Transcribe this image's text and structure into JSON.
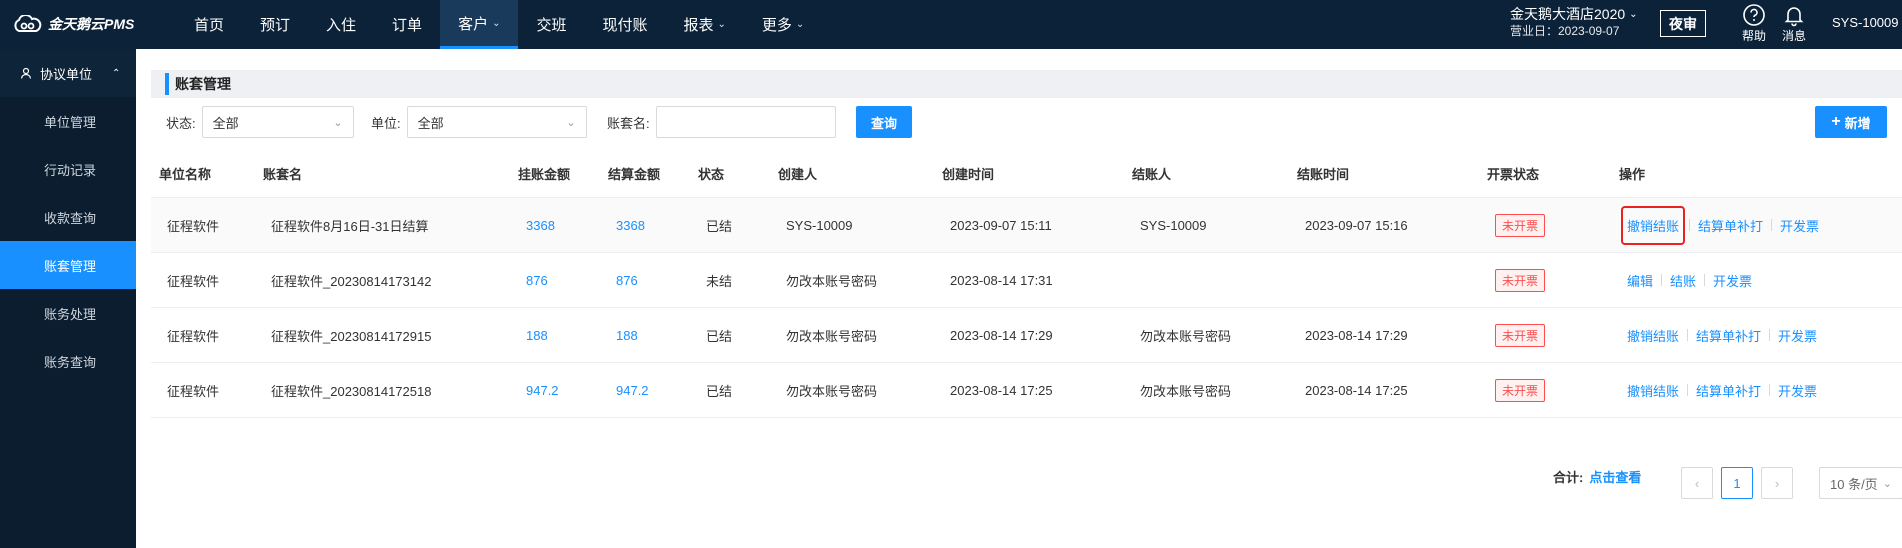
{
  "app": {
    "logo_text": "金天鹅云PMS"
  },
  "nav": [
    {
      "label": "首页",
      "active": false,
      "dropdown": false
    },
    {
      "label": "预订",
      "active": false,
      "dropdown": false
    },
    {
      "label": "入住",
      "active": false,
      "dropdown": false
    },
    {
      "label": "订单",
      "active": false,
      "dropdown": false
    },
    {
      "label": "客户",
      "active": true,
      "dropdown": true
    },
    {
      "label": "交班",
      "active": false,
      "dropdown": false
    },
    {
      "label": "现付账",
      "active": false,
      "dropdown": false
    },
    {
      "label": "报表",
      "active": false,
      "dropdown": true
    },
    {
      "label": "更多",
      "active": false,
      "dropdown": true
    }
  ],
  "header": {
    "hotel_name": "金天鹅大酒店2020",
    "business_date": "营业日：2023-09-07",
    "night_audit": "夜审",
    "help": "帮助",
    "messages": "消息",
    "user": "SYS-10009"
  },
  "sidebar": {
    "group": "协议单位",
    "items": [
      {
        "label": "单位管理",
        "active": false
      },
      {
        "label": "行动记录",
        "active": false
      },
      {
        "label": "收款查询",
        "active": false
      },
      {
        "label": "账套管理",
        "active": true
      },
      {
        "label": "账务处理",
        "active": false
      },
      {
        "label": "账务查询",
        "active": false
      }
    ]
  },
  "page": {
    "title": "账套管理"
  },
  "filters": {
    "status_label": "状态:",
    "status_value": "全部",
    "unit_label": "单位:",
    "unit_value": "全部",
    "name_label": "账套名:",
    "name_value": "",
    "query_button": "查询",
    "add_button": "新增"
  },
  "table": {
    "columns": [
      "单位名称",
      "账套名",
      "挂账金额",
      "结算金额",
      "状态",
      "创建人",
      "创建时间",
      "结账人",
      "结账时间",
      "开票状态",
      "操作"
    ],
    "rows": [
      {
        "unit": "征程软件",
        "name": "征程软件8月16日-31日结算",
        "charge": "3368",
        "settle": "3368",
        "status": "已结",
        "creator": "SYS-10009",
        "created": "2023-09-07 15:11",
        "closer": "SYS-10009",
        "closed": "2023-09-07 15:16",
        "invoice": "未开票",
        "ops": [
          "撤销结账",
          "结算单补打",
          "开发票"
        ],
        "highlight_first": true
      },
      {
        "unit": "征程软件",
        "name": "征程软件_20230814173142",
        "charge": "876",
        "settle": "876",
        "status": "未结",
        "creator": "勿改本账号密码",
        "created": "2023-08-14 17:31",
        "closer": "",
        "closed": "",
        "invoice": "未开票",
        "ops": [
          "编辑",
          "结账",
          "开发票"
        ],
        "highlight_first": false
      },
      {
        "unit": "征程软件",
        "name": "征程软件_20230814172915",
        "charge": "188",
        "settle": "188",
        "status": "已结",
        "creator": "勿改本账号密码",
        "created": "2023-08-14 17:29",
        "closer": "勿改本账号密码",
        "closed": "2023-08-14 17:29",
        "invoice": "未开票",
        "ops": [
          "撤销结账",
          "结算单补打",
          "开发票"
        ],
        "highlight_first": false
      },
      {
        "unit": "征程软件",
        "name": "征程软件_20230814172518",
        "charge": "947.2",
        "settle": "947.2",
        "status": "已结",
        "creator": "勿改本账号密码",
        "created": "2023-08-14 17:25",
        "closer": "勿改本账号密码",
        "closed": "2023-08-14 17:25",
        "invoice": "未开票",
        "ops": [
          "撤销结账",
          "结算单补打",
          "开发票"
        ],
        "highlight_first": false
      }
    ]
  },
  "pagination": {
    "total_label": "合计:",
    "total_link": "点击查看",
    "current_page": "1",
    "page_size": "10 条/页"
  },
  "colors": {
    "topbar": "#0b2239",
    "sidebar": "#0b1d2e",
    "accent": "#1890ff",
    "danger": "#ff4d4f"
  }
}
